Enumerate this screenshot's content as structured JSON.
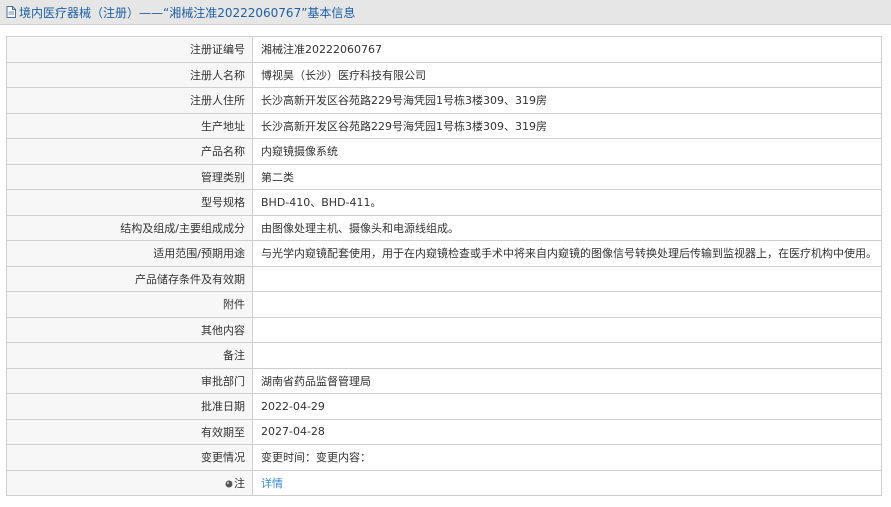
{
  "header": {
    "icon": "document-icon",
    "title": "境内医疗器械（注册）——“湘械注准20222060767”基本信息"
  },
  "rows": [
    {
      "label": "注册证编号",
      "value": "湘械注准20222060767"
    },
    {
      "label": "注册人名称",
      "value": "博视昊（长沙）医疗科技有限公司"
    },
    {
      "label": "注册人住所",
      "value": "长沙高新开发区谷苑路229号海凭园1号栋3楼309、319房"
    },
    {
      "label": "生产地址",
      "value": "长沙高新开发区谷苑路229号海凭园1号栋3楼309、319房"
    },
    {
      "label": "产品名称",
      "value": "内窥镜摄像系统"
    },
    {
      "label": "管理类别",
      "value": "第二类"
    },
    {
      "label": "型号规格",
      "value": "BHD-410、BHD-411。"
    },
    {
      "label": "结构及组成/主要组成成分",
      "value": "由图像处理主机、摄像头和电源线组成。"
    },
    {
      "label": "适用范围/预期用途",
      "value": "与光学内窥镜配套使用，用于在内窥镜检查或手术中将来自内窥镜的图像信号转换处理后传输到监视器上，在医疗机构中使用。"
    },
    {
      "label": "产品储存条件及有效期",
      "value": ""
    },
    {
      "label": "附件",
      "value": ""
    },
    {
      "label": "其他内容",
      "value": ""
    },
    {
      "label": "备注",
      "value": ""
    },
    {
      "label": "审批部门",
      "value": "湖南省药品监督管理局"
    },
    {
      "label": "批准日期",
      "value": "2022-04-29"
    },
    {
      "label": "有效期至",
      "value": "2027-04-28"
    },
    {
      "label": "变更情况",
      "value": "变更时间：变更内容："
    }
  ],
  "note_row": {
    "icon": "pin-icon",
    "label": "注",
    "link_text": "详情"
  },
  "colors": {
    "header_bg": "#e6e6e6",
    "title": "#1f5fa6",
    "link": "#3c8ad8",
    "border": "#cfcfcf"
  }
}
